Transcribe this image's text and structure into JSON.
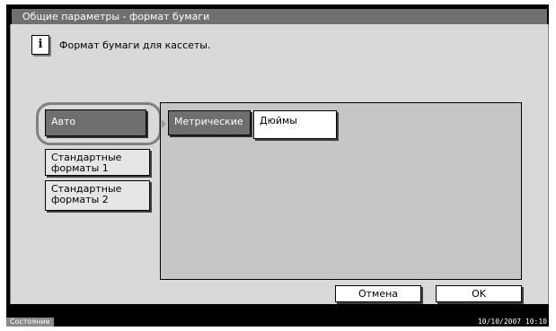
{
  "title": "Общие параметры - формат бумаги",
  "info_text": "Формат бумаги для кассеты.",
  "left_buttons": [
    {
      "label": "Авто"
    },
    {
      "label": "Стандартные\nформаты 1"
    },
    {
      "label": "Стандартные\nформаты 2"
    }
  ],
  "tabs": [
    {
      "label": "Метрические"
    },
    {
      "label": "Дюймы"
    }
  ],
  "cancel_label": "Отмена",
  "ok_label": "OK",
  "status_label": "Состояние",
  "status_datetime": "10/10/2007  10:10",
  "icons": {
    "info": "info-icon",
    "arrow": "arrow-right-icon"
  }
}
